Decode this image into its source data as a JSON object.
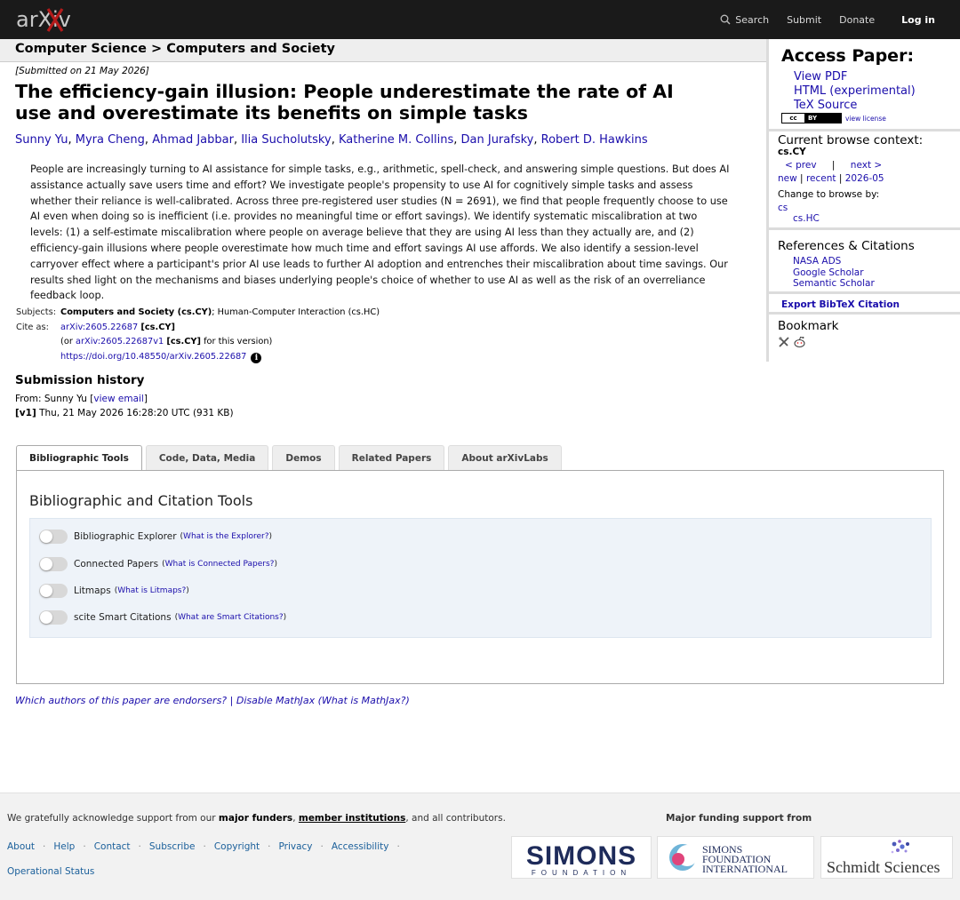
{
  "topbar": {
    "logo_text": "arXiv",
    "search_label": "Search",
    "submit_label": "Submit",
    "donate_label": "Donate",
    "login_label": "Log in"
  },
  "breadcrumb": "Computer Science > Computers and Society",
  "paper": {
    "submitted": "[Submitted on 21 May 2026]",
    "title": "The efficiency-gain illusion: People underestimate the rate of AI use and overestimate its benefits on simple tasks",
    "authors": [
      "Sunny Yu",
      "Myra Cheng",
      "Ahmad Jabbar",
      "Ilia Sucholutsky",
      "Katherine M. Collins",
      "Dan Jurafsky",
      "Robert D. Hawkins"
    ],
    "abstract": "People are increasingly turning to AI assistance for simple tasks, e.g., arithmetic, spell-check, and answering simple questions. But does AI assistance actually save users time and effort? We investigate people's propensity to use AI for cognitively simple tasks and assess whether their reliance is well-calibrated. Across three pre-registered user studies (N = 2691), we find that people frequently choose to use AI even when doing so is inefficient (i.e. provides no meaningful time or effort savings). We identify systematic miscalibration at two levels: (1) a self-estimate miscalibration where people on average believe that they are using AI less than they actually are, and (2) efficiency-gain illusions where people overestimate how much time and effort savings AI use affords. We also identify a session-level carryover effect where a participant's prior AI use leads to further AI adoption and entrenches their miscalibration about time savings. Our results shed light on the mechanisms and biases underlying people's choice of whether to use AI as well as the risk of an overreliance feedback loop."
  },
  "meta": {
    "subjects_label": "Subjects:",
    "subjects_primary": "Computers and Society (cs.CY)",
    "subjects_rest": "; Human-Computer Interaction (cs.HC)",
    "cite_label": "Cite as:",
    "cite_id": "arXiv:2605.22687",
    "cite_cat": "[cs.CY]",
    "or_prefix": "(or ",
    "cite_version": "arXiv:2605.22687v1",
    "or_suffix": " for this version)",
    "doi": "https://doi.org/10.48550/arXiv.2605.22687",
    "info_glyph": "i"
  },
  "history": {
    "heading": "Submission history",
    "from_prefix": "From: Sunny Yu [",
    "view_email": "view email",
    "from_suffix": "]",
    "version": "[v1]",
    "version_detail": " Thu, 21 May 2026 16:28:20 UTC (931 KB)"
  },
  "tabs": [
    "Bibliographic Tools",
    "Code, Data, Media",
    "Demos",
    "Related Papers",
    "About arXivLabs"
  ],
  "panel": {
    "title": "Bibliographic and Citation Tools",
    "tools": [
      {
        "label": "Bibliographic Explorer",
        "help": "What is the Explorer?"
      },
      {
        "label": "Connected Papers",
        "help": "What is Connected Papers?"
      },
      {
        "label": "Litmaps",
        "help": "What is Litmaps?"
      },
      {
        "label": "scite Smart Citations",
        "help": "What are Smart Citations?"
      }
    ]
  },
  "endorsers": {
    "link1": "Which authors of this paper are endorsers?",
    "sep": " | ",
    "link2": "Disable MathJax",
    "link3": " (What is MathJax?)"
  },
  "sidebar": {
    "access_heading": "Access Paper:",
    "access_links": [
      "View PDF",
      "HTML (experimental)",
      "TeX Source"
    ],
    "cc_left": "cc",
    "cc_right": "BY",
    "view_license": "view license",
    "browse_heading": "Current browse context:",
    "browse_context": "cs.CY",
    "prev": "< prev",
    "pipe": "|",
    "next": "next >",
    "new": "new",
    "recent": "recent",
    "month": "2026-05",
    "change_browse": "Change to browse by:",
    "browse_cs": "cs",
    "browse_cshc": "cs.HC",
    "refs_heading": "References & Citations",
    "refs_links": [
      "NASA ADS",
      "Google Scholar",
      "Semantic Scholar"
    ],
    "bibtex": "Export BibTeX Citation",
    "bookmark_heading": "Bookmark"
  },
  "footer": {
    "ack_prefix": "We gratefully acknowledge support from our ",
    "major_funders": "major funders",
    "comma": ", ",
    "member_institutions": "member institutions",
    "ack_suffix": ", and all contributors.",
    "links": [
      "About",
      "Help",
      "Contact",
      "Subscribe",
      "Copyright",
      "Privacy",
      "Accessibility"
    ],
    "operational_status": "Operational Status",
    "major_funding": "Major funding support from",
    "sponsor_simons": "SIMONS",
    "sponsor_simons_sub": "FOUNDATION",
    "sponsor_sfi_1": "SIMONS",
    "sponsor_sfi_2": "FOUNDATION",
    "sponsor_sfi_3": "INTERNATIONAL",
    "sponsor_schmidt": "Schmidt Sciences"
  },
  "colors": {
    "topbar": "#1a1a1a",
    "link": "#1a0dab",
    "logo_red": "#b31b1b"
  }
}
